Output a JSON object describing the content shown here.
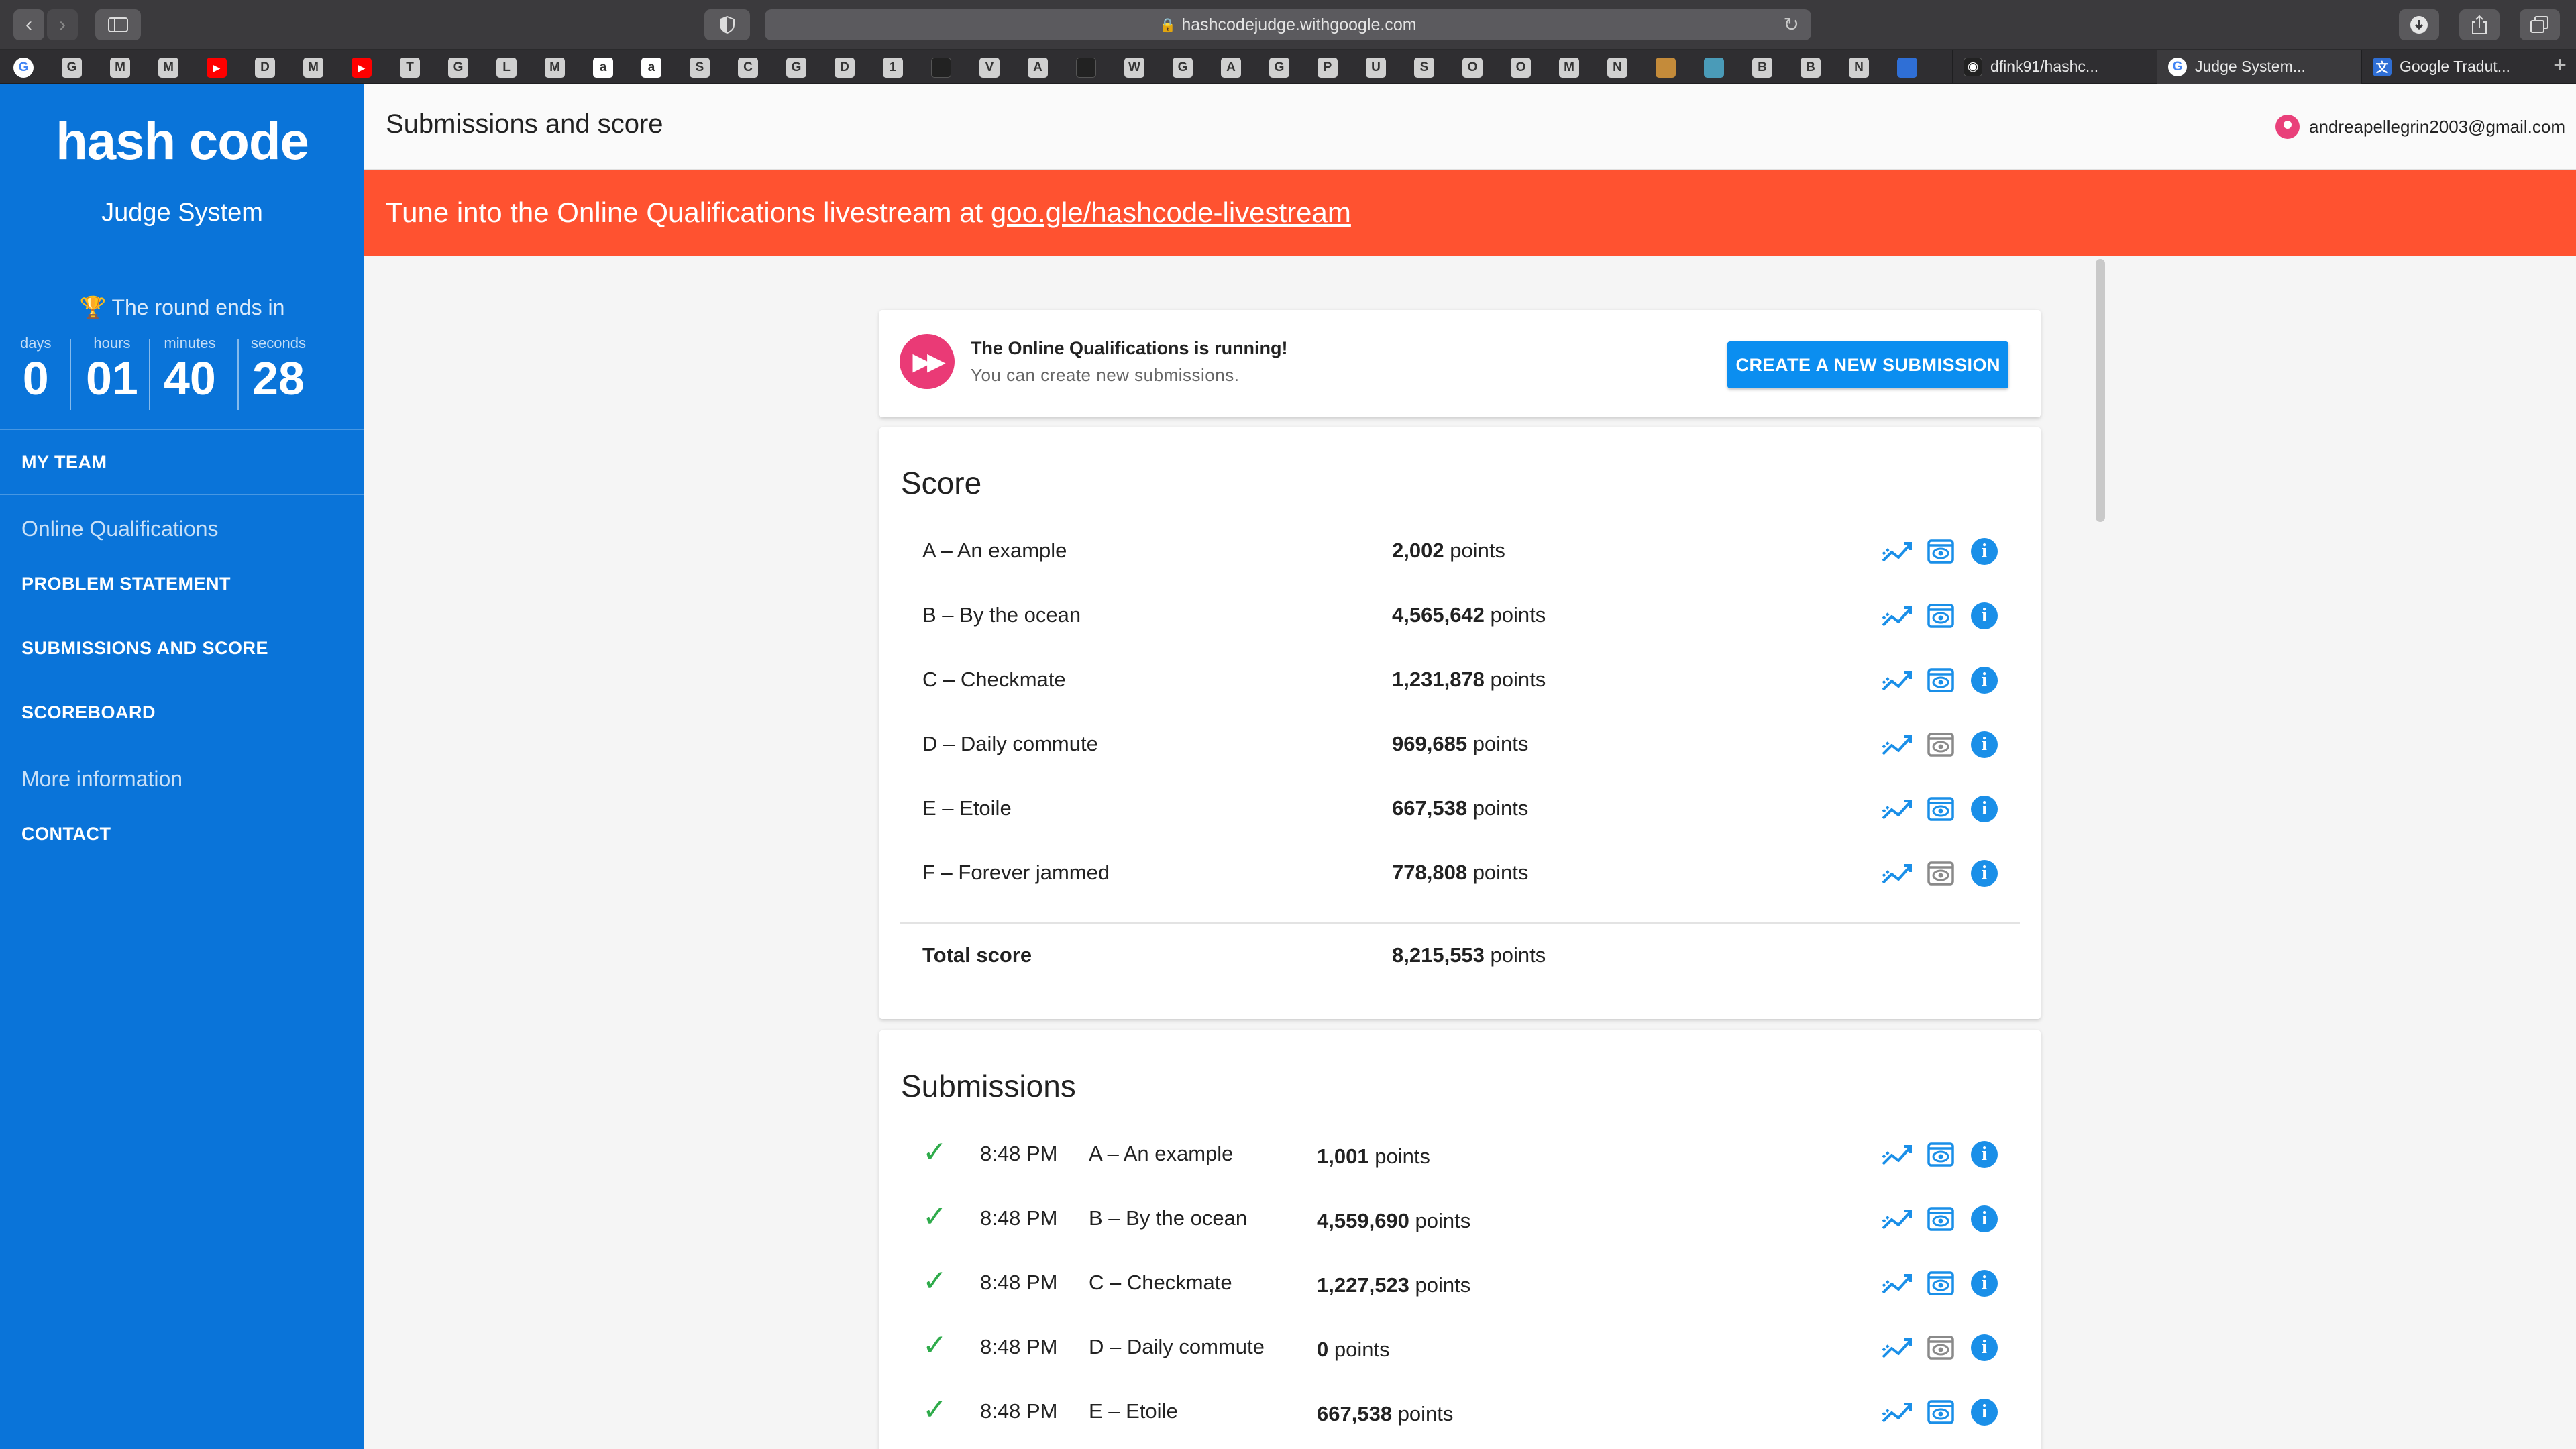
{
  "browser": {
    "url": "hashcodejudge.withgoogle.com",
    "bookmarks": [
      "G",
      "G",
      "M",
      "M",
      "▶",
      "D",
      "M",
      "▶",
      "T",
      "G",
      "L",
      "M",
      "a",
      "a",
      "S",
      "C",
      "G",
      "D",
      "1",
      "",
      "V",
      "A",
      "",
      "W",
      "G",
      "A",
      "G",
      "P",
      "U",
      "S",
      "O",
      "O",
      "M",
      "N",
      "",
      "",
      "B",
      "B",
      "N",
      ""
    ],
    "tabs": [
      {
        "label": "dfink91/hashc...",
        "icon": "github-icon"
      },
      {
        "label": "Judge System...",
        "icon": "google-icon"
      },
      {
        "label": "Google Tradut...",
        "icon": "translate-icon"
      }
    ]
  },
  "sidebar": {
    "logo": "hash code",
    "subtitle": "Judge System",
    "countdown": {
      "label": "The round ends in",
      "units": [
        {
          "label": "days",
          "value": "0"
        },
        {
          "label": "hours",
          "value": "01"
        },
        {
          "label": "minutes",
          "value": "40"
        },
        {
          "label": "seconds",
          "value": "28"
        }
      ]
    },
    "my_team": "MY TEAM",
    "online_heading": "Online Qualifications",
    "problem_statement": "PROBLEM STATEMENT",
    "submissions_and_score": "SUBMISSIONS AND SCORE",
    "scoreboard": "SCOREBOARD",
    "more_heading": "More information",
    "contact": "CONTACT"
  },
  "header": {
    "title": "Submissions and score",
    "user_email": "andreapellegrin2003@gmail.com"
  },
  "banner": {
    "text": "Tune into the Online Qualifications livestream at ",
    "link": "goo.gle/hashcode-livestream"
  },
  "status": {
    "title": "The Online Qualifications is running!",
    "subtitle": "You can create new submissions.",
    "button": "CREATE A NEW SUBMISSION"
  },
  "score": {
    "title": "Score",
    "unit": "points",
    "rows": [
      {
        "name": "A – An example",
        "points": "2,002",
        "view_enabled": true
      },
      {
        "name": "B – By the ocean",
        "points": "4,565,642",
        "view_enabled": true
      },
      {
        "name": "C – Checkmate",
        "points": "1,231,878",
        "view_enabled": true
      },
      {
        "name": "D – Daily commute",
        "points": "969,685",
        "view_enabled": false
      },
      {
        "name": "E – Etoile",
        "points": "667,538",
        "view_enabled": true
      },
      {
        "name": "F – Forever jammed",
        "points": "778,808",
        "view_enabled": false
      }
    ],
    "total_label": "Total score",
    "total_points": "8,215,553"
  },
  "submissions": {
    "title": "Submissions",
    "unit": "points",
    "rows": [
      {
        "time": "8:48 PM",
        "name": "A – An example",
        "points": "1,001",
        "view_enabled": true
      },
      {
        "time": "8:48 PM",
        "name": "B – By the ocean",
        "points": "4,559,690",
        "view_enabled": true
      },
      {
        "time": "8:48 PM",
        "name": "C – Checkmate",
        "points": "1,227,523",
        "view_enabled": true
      },
      {
        "time": "8:48 PM",
        "name": "D – Daily commute",
        "points": "0",
        "view_enabled": false
      },
      {
        "time": "8:48 PM",
        "name": "E – Etoile",
        "points": "667,538",
        "view_enabled": true
      }
    ]
  },
  "colors": {
    "sidebar": "#0a74d9",
    "banner": "#ff5230",
    "accent": "#0b8ef0",
    "status_icon": "#ea3a76",
    "check": "#2fab4b"
  }
}
